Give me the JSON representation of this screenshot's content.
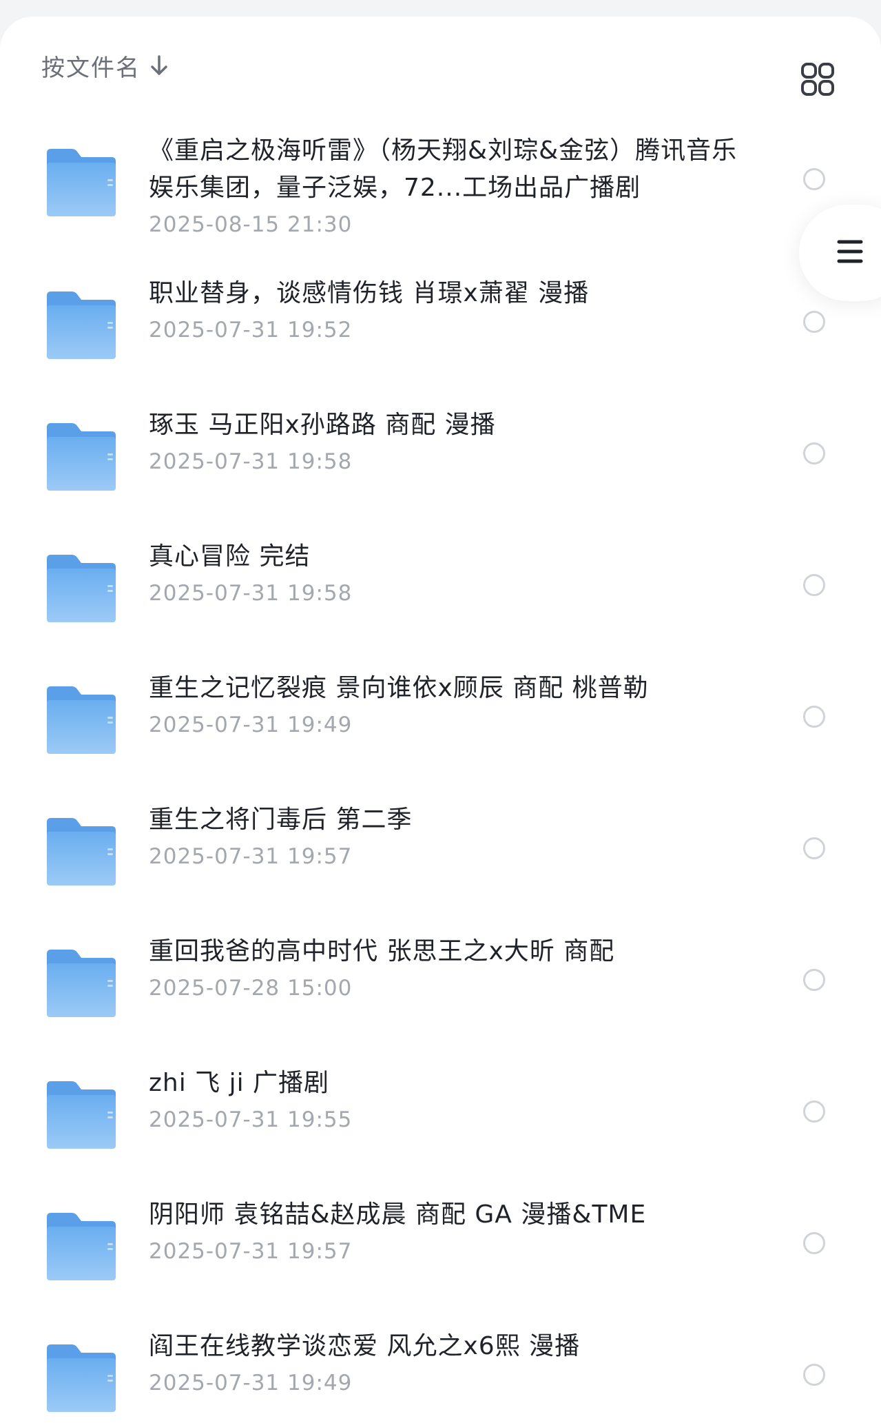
{
  "toolbar": {
    "sort_label": "按文件名",
    "sort_icon": "arrow-down-icon",
    "view_toggle_icon": "grid-view-icon"
  },
  "floating_menu": {
    "icon": "hamburger-menu-icon"
  },
  "colors": {
    "folder": "#6aaef0",
    "folder_light": "#9ccaf6",
    "text_primary": "#1f2329",
    "text_secondary": "#a3a7ae",
    "radio_border": "#d0d3d8"
  },
  "files": [
    {
      "name": "《重启之极海听雷》（杨天翔&刘琮&金弦）腾讯音乐娱乐集团，量子泛娱，72...工场出品广播剧",
      "date": "2025-08-15 21:30"
    },
    {
      "name": "职业替身，谈感情伤钱 肖璟x萧翟 漫播",
      "date": "2025-07-31 19:52"
    },
    {
      "name": "琢玉 马正阳x孙路路 商配 漫播",
      "date": "2025-07-31 19:58"
    },
    {
      "name": "真心冒险 完结",
      "date": "2025-07-31 19:58"
    },
    {
      "name": "重生之记忆裂痕 景向谁依x顾辰 商配 桃普勒",
      "date": "2025-07-31 19:49"
    },
    {
      "name": "重生之将门毒后 第二季",
      "date": "2025-07-31 19:57"
    },
    {
      "name": "重回我爸的高中时代 张思王之x大昕 商配",
      "date": "2025-07-28 15:00"
    },
    {
      "name": "zhi 飞 ji 广播剧",
      "date": "2025-07-31 19:55"
    },
    {
      "name": "阴阳师 袁铭喆&赵成晨 商配 GA 漫播&TME",
      "date": "2025-07-31 19:57"
    },
    {
      "name": "阎王在线教学谈恋爱 风允之x6熙 漫播",
      "date": "2025-07-31 19:49"
    }
  ]
}
